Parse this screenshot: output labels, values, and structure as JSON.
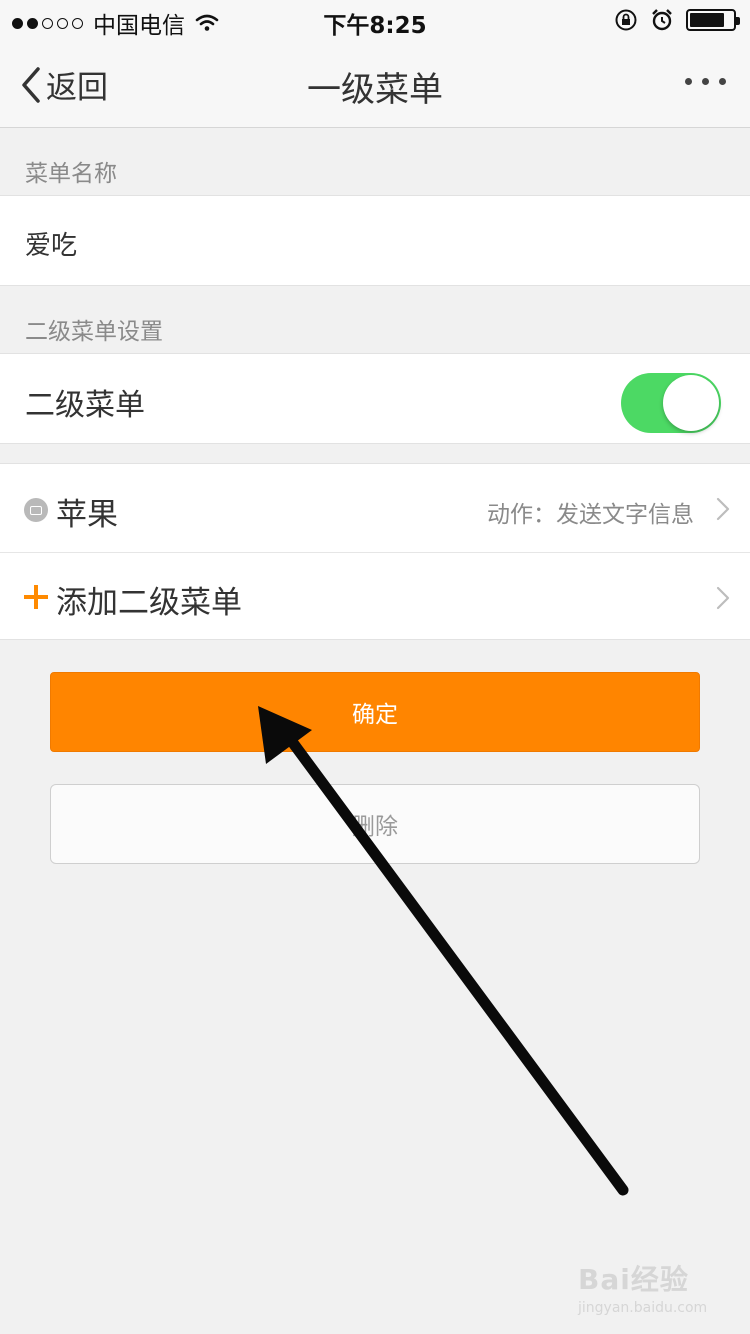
{
  "status_bar": {
    "carrier": "中国电信",
    "time": "下午8:25",
    "signal_bars_filled": 2,
    "signal_bars_total": 5,
    "battery_level": 0.8
  },
  "nav": {
    "back_label": "返回",
    "title": "一级菜单"
  },
  "menu_name": {
    "section_label": "菜单名称",
    "value": "爱吃"
  },
  "submenu_settings": {
    "section_label": "二级菜单设置",
    "toggle_label": "二级菜单",
    "toggle_on": true
  },
  "submenus": {
    "items": [
      {
        "label": "苹果",
        "action": "动作：发送文字信息"
      }
    ],
    "add_label": "添加二级菜单"
  },
  "buttons": {
    "confirm": "确定",
    "delete": "删除"
  },
  "watermark": {
    "brand": "Bai经验",
    "url": "jingyan.baidu.com"
  },
  "colors": {
    "accent": "#ff8500",
    "toggle_on": "#4cd964",
    "background": "#f1f1f1"
  }
}
